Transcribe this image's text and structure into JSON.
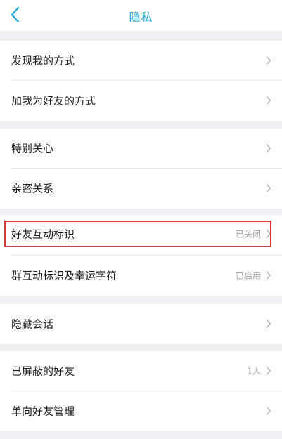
{
  "header": {
    "title": "隐私",
    "back_icon": "chevron-left-icon"
  },
  "colors": {
    "accent": "#1ea6d8",
    "highlight_border": "#d33a3a",
    "background": "#eff0f4"
  },
  "groups": [
    {
      "items": [
        {
          "label": "发现我的方式"
        },
        {
          "label": "加我为好友的方式"
        }
      ]
    },
    {
      "items": [
        {
          "label": "特别关心"
        },
        {
          "label": "亲密关系"
        }
      ]
    },
    {
      "items": [
        {
          "label": "好友互动标识",
          "value": "已关闭"
        },
        {
          "label": "群互动标识及幸运字符",
          "value": "已启用"
        }
      ]
    },
    {
      "items": [
        {
          "label": "隐藏会话"
        }
      ]
    },
    {
      "items": [
        {
          "label": "已屏蔽的好友",
          "value": "1人"
        },
        {
          "label": "单向好友管理"
        }
      ]
    }
  ]
}
